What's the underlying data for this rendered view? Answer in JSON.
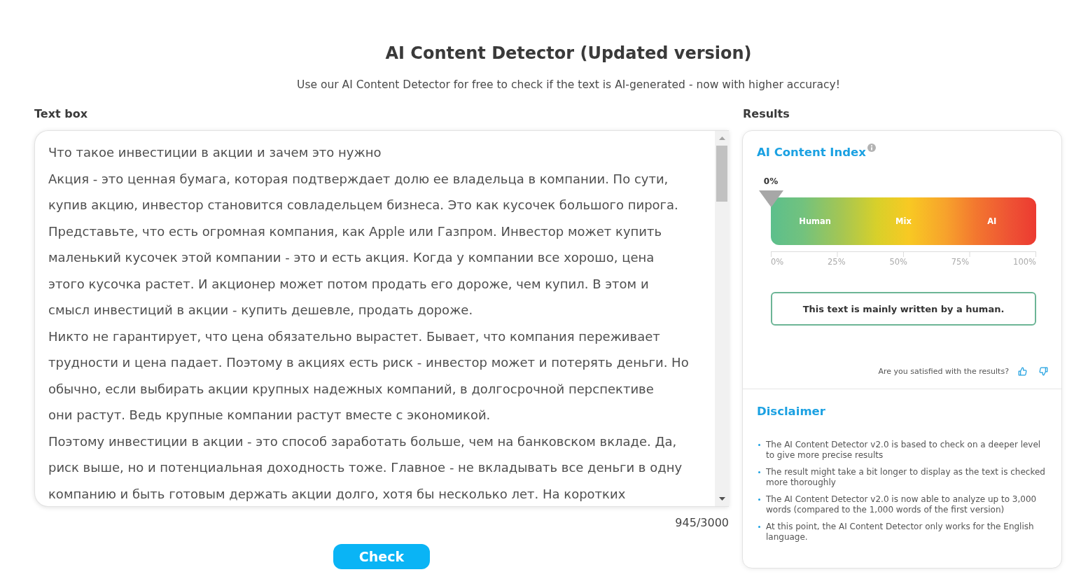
{
  "header": {
    "title": "AI Content Detector (Updated version)",
    "subtitle": "Use our AI Content Detector for free to check if the text is AI-generated - now with higher accuracy!"
  },
  "text_box": {
    "label": "Text box",
    "paragraphs": [
      {
        "lines": [
          "Что такое инвестиции в акции и зачем это нужно"
        ]
      },
      {
        "lines": [
          "Акция - это ценная бумага, которая подтверждает долю ее владельца в компании. По сути,",
          "купив акцию, инвестор становится совладельцем бизнеса. Это как кусочек большого пирога.",
          "Представьте, что есть огромная компания, как Apple или Газпром. Инвестор может купить",
          "маленький кусочек этой компании - это и есть акция. Когда у компании все хорошо, цена",
          "этого кусочка растет. И акционер может потом продать его дороже, чем купил. В этом и",
          "смысл инвестиций в акции - купить дешевле, продать дороже."
        ]
      },
      {
        "lines": [
          "Никто не гарантирует, что цена обязательно вырастет. Бывает, что компания переживает",
          "трудности и цена падает. Поэтому в акциях есть риск - инвестор может и потерять деньги. Но",
          "обычно, если выбирать акции крупных надежных компаний, в долгосрочной перспективе",
          "они растут. Ведь крупные компании растут вместе с экономикой."
        ]
      },
      {
        "lines": [
          "Поэтому инвестиции в акции - это способ заработать больше, чем на банковском вкладе. Да,",
          "риск выше, но и потенциальная доходность тоже. Главное - не вкладывать все деньги в одну",
          "компанию и быть готовым держать акции долго, хотя бы несколько лет. На коротких"
        ]
      }
    ],
    "counter": "945/3000"
  },
  "check_button": "Check",
  "results": {
    "label": "Results",
    "index_title": "AI Content Index",
    "score": "0%",
    "level": 0,
    "zones": [
      "Human",
      "Mix",
      "AI"
    ],
    "scale": [
      "0%",
      "25%",
      "50%",
      "75%",
      "100%"
    ],
    "verdict": "This text is mainly written by a human.",
    "feedback_prompt": "Are you satisfied with the results?"
  },
  "disclaimer": {
    "title": "Disclaimer",
    "items": [
      "The AI Content Detector v2.0 is based to check on a deeper level to give more precise results",
      "The result might take a bit longer to display as the text is checked more thoroughly",
      "The AI Content Detector v2.0 is now able to analyze up to 3,000 words (compared to the 1,000 words of the first version)",
      "At this point, the AI Content Detector only works for the English language."
    ]
  }
}
